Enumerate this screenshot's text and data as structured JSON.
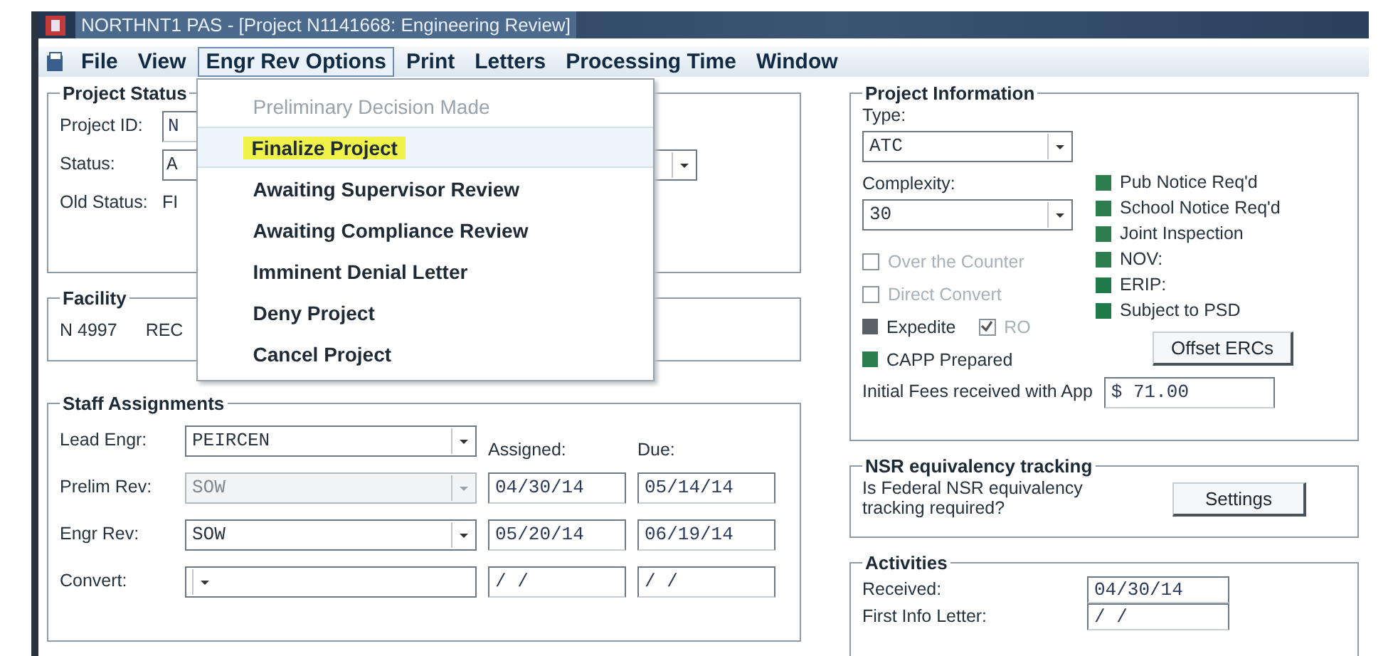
{
  "window": {
    "title": "NORTHNT1 PAS - [Project N1141668: Engineering Review]"
  },
  "menu_bar": [
    {
      "label": "File",
      "selected": false
    },
    {
      "label": "View",
      "selected": false
    },
    {
      "label": "Engr Rev Options",
      "selected": true
    },
    {
      "label": "Print",
      "selected": false
    },
    {
      "label": "Letters",
      "selected": false
    },
    {
      "label": "Processing Time",
      "selected": false
    },
    {
      "label": "Window",
      "selected": false
    }
  ],
  "dropdown_menu": [
    {
      "label": "Preliminary Decision Made",
      "disabled": true,
      "selected": false
    },
    {
      "label": "Finalize Project",
      "disabled": false,
      "selected": true
    },
    {
      "label": "Awaiting Supervisor Review",
      "disabled": false,
      "selected": false
    },
    {
      "label": "Awaiting Compliance Review",
      "disabled": false,
      "selected": false
    },
    {
      "label": "Imminent Denial Letter",
      "disabled": false,
      "selected": false
    },
    {
      "label": "Deny Project",
      "disabled": false,
      "selected": false
    },
    {
      "label": "Cancel Project",
      "disabled": false,
      "selected": false
    }
  ],
  "project_status": {
    "title": "Project Status",
    "project_id_label": "Project ID:",
    "project_id": "N",
    "status_label": "Status:",
    "status": "A",
    "old_status_label": "Old Status:",
    "old_status": "FI"
  },
  "facility": {
    "title": "Facility",
    "id": "N 4997",
    "name": "REC"
  },
  "staff_assignments": {
    "title": "Staff Assignments",
    "assigned_label": "Assigned:",
    "due_label": "Due:",
    "rows": [
      {
        "label": "Lead Engr:",
        "value": "PEIRCEN",
        "disabled": false
      },
      {
        "label": "Prelim Rev:",
        "value": "SOW",
        "disabled": true,
        "assigned": "04/30/14",
        "due": "05/14/14"
      },
      {
        "label": "Engr Rev:",
        "value": "SOW",
        "disabled": false,
        "assigned": "05/20/14",
        "due": "06/19/14"
      },
      {
        "label": "Convert:",
        "value": "",
        "disabled": false,
        "assigned": "/ /",
        "due": "/ /"
      }
    ]
  },
  "project_information": {
    "title": "Project Information",
    "type_label": "Type:",
    "type": "ATC",
    "complexity_label": "Complexity:",
    "complexity": "30",
    "checkboxes": [
      {
        "label": "Over the Counter",
        "checked": false,
        "disabled": true
      },
      {
        "label": "Direct Convert",
        "checked": false,
        "disabled": true
      }
    ],
    "expedite": {
      "label": "Expedite",
      "color": "#5a6068"
    },
    "ro": {
      "label": "RO",
      "checked": true,
      "disabled": true
    },
    "capp": {
      "label": "CAPP Prepared",
      "color": "#2e7d4f"
    },
    "indicators": [
      {
        "label": "Pub Notice Req'd",
        "color": "#2e7d4f"
      },
      {
        "label": "School Notice Req'd",
        "color": "#2e7d4f"
      },
      {
        "label": "Joint Inspection",
        "color": "#2e7d4f"
      },
      {
        "label": "NOV:",
        "color": "#2e7d4f"
      },
      {
        "label": "ERIP:",
        "color": "#1f7a4a"
      },
      {
        "label": "Subject to PSD",
        "color": "#1f7a4a"
      }
    ],
    "offset_button": "Offset ERCs",
    "fees_label": "Initial Fees received with App",
    "fees": "$ 71.00"
  },
  "nsr_tracking": {
    "title": "NSR equivalency tracking",
    "question": "Is Federal NSR equivalency tracking required?",
    "button": "Settings"
  },
  "activities": {
    "title": "Activities",
    "rows": [
      {
        "label": "Received:",
        "value": "04/30/14"
      },
      {
        "label": "First Info Letter:",
        "value": "/ /"
      }
    ]
  }
}
